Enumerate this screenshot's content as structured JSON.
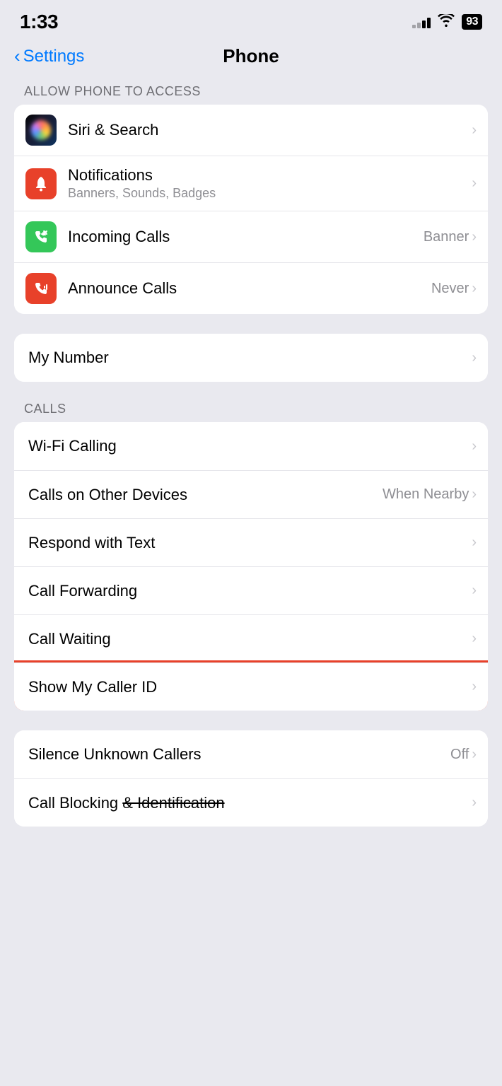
{
  "statusBar": {
    "time": "1:33",
    "battery": "93"
  },
  "header": {
    "backLabel": "Settings",
    "title": "Phone"
  },
  "sections": {
    "allowPhoneAccess": {
      "header": "ALLOW PHONE TO ACCESS",
      "items": [
        {
          "id": "siri-search",
          "icon": "siri",
          "title": "Siri & Search",
          "subtitle": "",
          "value": ""
        },
        {
          "id": "notifications",
          "icon": "notifications",
          "title": "Notifications",
          "subtitle": "Banners, Sounds, Badges",
          "value": ""
        },
        {
          "id": "incoming-calls",
          "icon": "incoming-calls",
          "title": "Incoming Calls",
          "subtitle": "",
          "value": "Banner"
        },
        {
          "id": "announce-calls",
          "icon": "announce-calls",
          "title": "Announce Calls",
          "subtitle": "",
          "value": "Never"
        }
      ]
    },
    "myNumber": {
      "items": [
        {
          "id": "my-number",
          "title": "My Number",
          "subtitle": "",
          "value": ""
        }
      ]
    },
    "calls": {
      "header": "CALLS",
      "items": [
        {
          "id": "wifi-calling",
          "title": "Wi-Fi Calling",
          "subtitle": "",
          "value": "",
          "highlighted": false
        },
        {
          "id": "calls-other-devices",
          "title": "Calls on Other Devices",
          "subtitle": "",
          "value": "When Nearby",
          "highlighted": false
        },
        {
          "id": "respond-text",
          "title": "Respond with Text",
          "subtitle": "",
          "value": "",
          "highlighted": false
        },
        {
          "id": "call-forwarding",
          "title": "Call Forwarding",
          "subtitle": "",
          "value": "",
          "highlighted": false
        },
        {
          "id": "call-waiting",
          "title": "Call Waiting",
          "subtitle": "",
          "value": "",
          "highlighted": false
        },
        {
          "id": "show-caller-id",
          "title": "Show My Caller ID",
          "subtitle": "",
          "value": "",
          "highlighted": true
        }
      ]
    },
    "bottomCalls": {
      "items": [
        {
          "id": "silence-unknown",
          "title": "Silence Unknown Callers",
          "value": "Off",
          "strikethrough": false
        },
        {
          "id": "call-blocking",
          "title": "Call Blocking & Identification",
          "value": "",
          "strikethrough": true
        }
      ]
    }
  },
  "icons": {
    "chevronRight": "›"
  }
}
